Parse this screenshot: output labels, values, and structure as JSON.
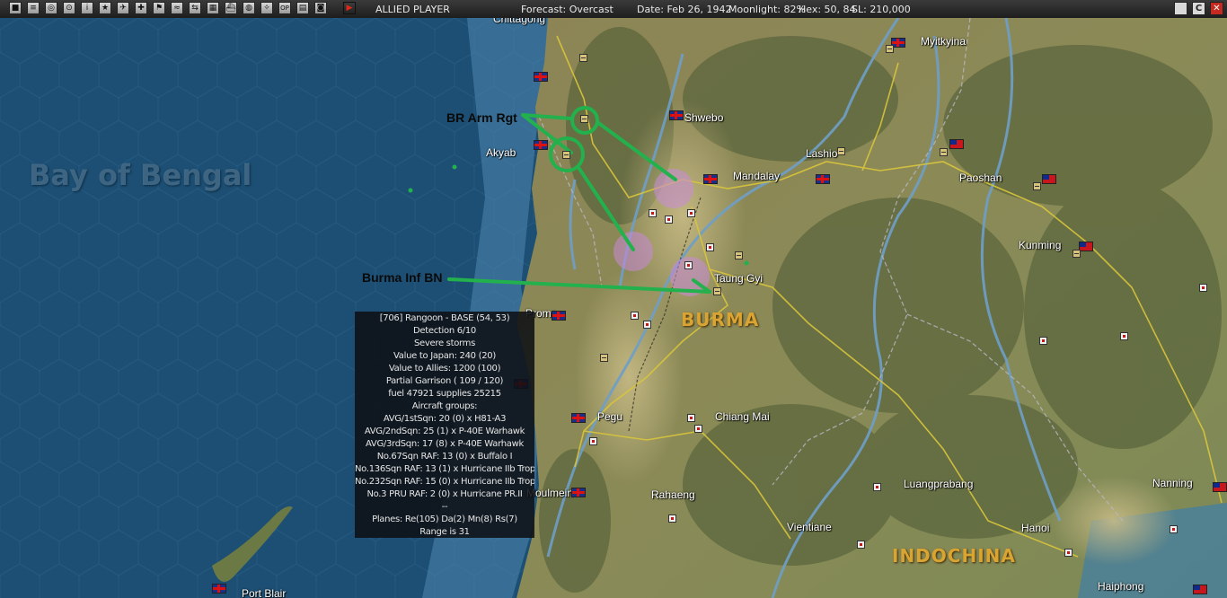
{
  "toolbar": {
    "buttons": [
      {
        "name": "menu-icon",
        "glyph": "■"
      },
      {
        "name": "report-icon",
        "glyph": "≡"
      },
      {
        "name": "turn-icon",
        "glyph": "◎"
      },
      {
        "name": "replay-icon",
        "glyph": "⊙"
      },
      {
        "name": "info-icon",
        "glyph": "i"
      },
      {
        "name": "star-icon",
        "glyph": "★"
      },
      {
        "name": "aircraft-icon",
        "glyph": "✈"
      },
      {
        "name": "ship-icon",
        "glyph": "✚"
      },
      {
        "name": "flag-icon",
        "glyph": "⚑"
      },
      {
        "name": "terrain-icon",
        "glyph": "≈"
      },
      {
        "name": "route-icon",
        "glyph": "⇆"
      },
      {
        "name": "chart-icon",
        "glyph": "▦"
      },
      {
        "name": "boat-icon",
        "glyph": "⛴"
      },
      {
        "name": "globe-icon",
        "glyph": "◍"
      },
      {
        "name": "tracker-icon",
        "glyph": "✧"
      },
      {
        "name": "op-icon",
        "glyph": "OP"
      },
      {
        "name": "map-icon",
        "glyph": "▤"
      },
      {
        "name": "options-icon",
        "glyph": "◙"
      },
      {
        "name": "end-turn-icon",
        "glyph": "▶"
      }
    ],
    "player": "ALLIED PLAYER",
    "forecast": "Forecast: Overcast",
    "date": "Date: Feb 26, 1942",
    "moonlight": "Moonlight: 82%",
    "hex": "Hex: 50, 84",
    "sl": "SL: 210,000",
    "window_buttons": [
      "",
      "C",
      "✕"
    ]
  },
  "map": {
    "places": [
      {
        "id": "chittagong",
        "text": "Chittagong"
      },
      {
        "id": "akyab",
        "text": "Akyab"
      },
      {
        "id": "myitkyina",
        "text": "Myitkyina"
      },
      {
        "id": "shwebo",
        "text": "Shwebo"
      },
      {
        "id": "lashio",
        "text": "Lashio"
      },
      {
        "id": "mandalay",
        "text": "Mandalay"
      },
      {
        "id": "paoshan",
        "text": "Paoshan"
      },
      {
        "id": "kunming",
        "text": "Kunming"
      },
      {
        "id": "taunggyi",
        "text": "Taung Gyi"
      },
      {
        "id": "prome",
        "text": "Prome"
      },
      {
        "id": "pegu",
        "text": "Pegu"
      },
      {
        "id": "chiangmai",
        "text": "Chiang Mai"
      },
      {
        "id": "moulmein",
        "text": "Moulmein"
      },
      {
        "id": "rahaeng",
        "text": "Rahaeng"
      },
      {
        "id": "luangprabang",
        "text": "Luangprabang"
      },
      {
        "id": "nanning",
        "text": "Nanning"
      },
      {
        "id": "vientiane",
        "text": "Vientiane"
      },
      {
        "id": "hanoi",
        "text": "Hanoi"
      },
      {
        "id": "haiphong",
        "text": "Haiphong"
      },
      {
        "id": "portblair",
        "text": "Port Blair"
      }
    ],
    "regions": {
      "burma": "BURMA",
      "indochina": "INDOCHINA",
      "bay": "Bay of Bengal"
    },
    "annotations": {
      "armored": "BR Arm Rgt",
      "infantry": "Burma Inf BN"
    },
    "colors": {
      "sea": "#1d4f74",
      "land": "#8c8c55",
      "river": "#6f9fc8",
      "road": "#d9c53c",
      "border": "#b8b8c0",
      "annotation": "#22b14c",
      "enemy_zone": "#c98ad8"
    }
  },
  "info_panel": {
    "lines": [
      "[706] Rangoon - BASE (54, 53)",
      "Detection 6/10",
      "Severe storms",
      "Value to Japan: 240 (20)",
      "Value to Allies: 1200 (100)",
      "Partial Garrison ( 109 / 120)",
      "fuel 47921 supplies 25215",
      "Aircraft groups:",
      "AVG/1stSqn: 20 (0) x H81-A3",
      "AVG/2ndSqn: 25 (1) x P-40E Warhawk",
      "AVG/3rdSqn: 17 (8) x P-40E Warhawk",
      "No.67Sqn RAF: 13 (0) x Buffalo I",
      "No.136Sqn RAF: 13 (1) x Hurricane IIb Trop",
      "No.232Sqn RAF: 15 (0) x Hurricane IIb Trop",
      "No.3 PRU RAF: 2 (0) x Hurricane PR.II",
      "--",
      "Planes: Re(105) Da(2) Mn(8) Rs(7)",
      "Range is 31"
    ]
  }
}
